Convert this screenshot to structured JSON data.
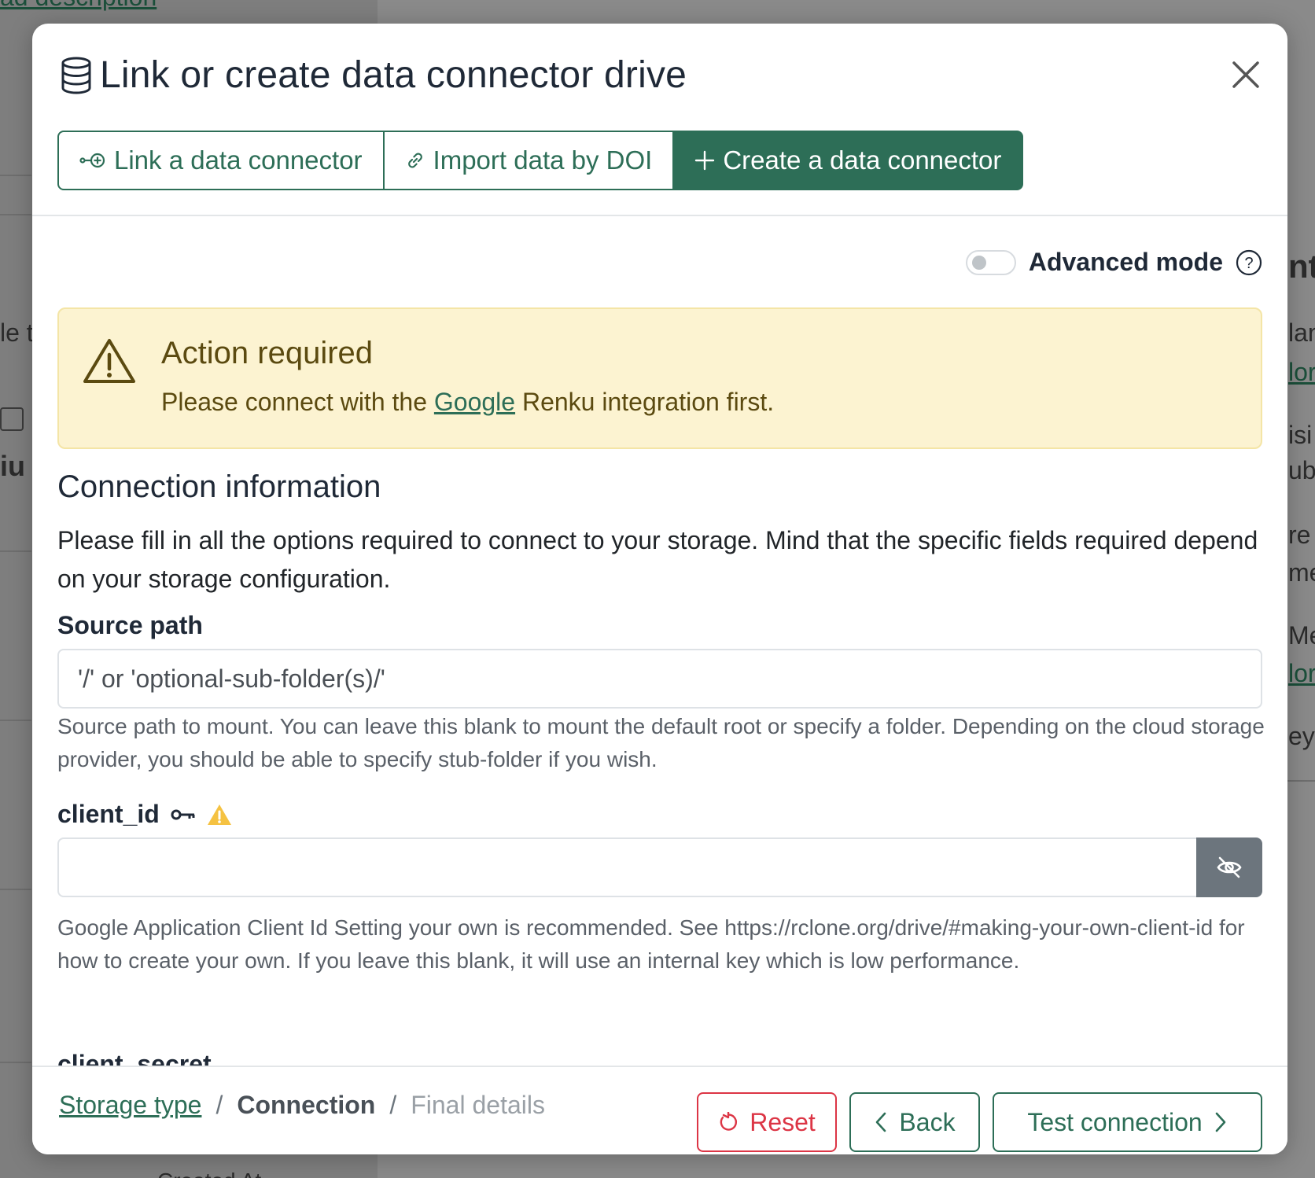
{
  "background": {
    "top_link": "ad description",
    "fragments": [
      "le t",
      "iu",
      "nt",
      "lan",
      "lor",
      "isi",
      "ub",
      "re",
      "me",
      "Mer",
      "lor",
      "ey",
      "Created At"
    ]
  },
  "modal": {
    "title": "Link or create data connector drive",
    "tabs": [
      {
        "label": "Link a data connector",
        "icon": "link-plus-icon"
      },
      {
        "label": "Import data by DOI",
        "icon": "link-icon"
      },
      {
        "label": "Create a data connector",
        "icon": "plus-icon",
        "active": true
      }
    ],
    "advanced_mode": {
      "label": "Advanced mode",
      "enabled": false
    },
    "alert": {
      "title": "Action required",
      "text_before": "Please connect with the ",
      "link": "Google",
      "text_after": " Renku integration first."
    },
    "section": {
      "title": "Connection information",
      "description": "Please fill in all the options required to connect to your storage. Mind that the specific fields required depend on your storage configuration."
    },
    "fields": {
      "source_path": {
        "label": "Source path",
        "placeholder": "'/' or 'optional-sub-folder(s)/'",
        "value": "",
        "help": "Source path to mount. You can leave this blank to mount the default root or specify a folder. Depending on the cloud storage provider, you should be able to specify stub-folder if you wish."
      },
      "client_id": {
        "label": "client_id",
        "value": "",
        "help": "Google Application Client Id Setting your own is recommended. See https://rclone.org/drive/#making-your-own-client-id for how to create your own. If you leave this blank, it will use an internal key which is low performance."
      },
      "client_secret": {
        "label": "client_secret"
      }
    },
    "footer": {
      "breadcrumb": {
        "step1": "Storage type",
        "step2": "Connection",
        "step3": "Final details",
        "separator": "/"
      },
      "reset_label": "Reset",
      "back_label": "Back",
      "test_label": "Test connection"
    }
  },
  "colors": {
    "primary": "#2d6e57",
    "danger": "#dc3545",
    "alert_bg": "#fcf3d1",
    "warning_icon": "#f5c242"
  }
}
